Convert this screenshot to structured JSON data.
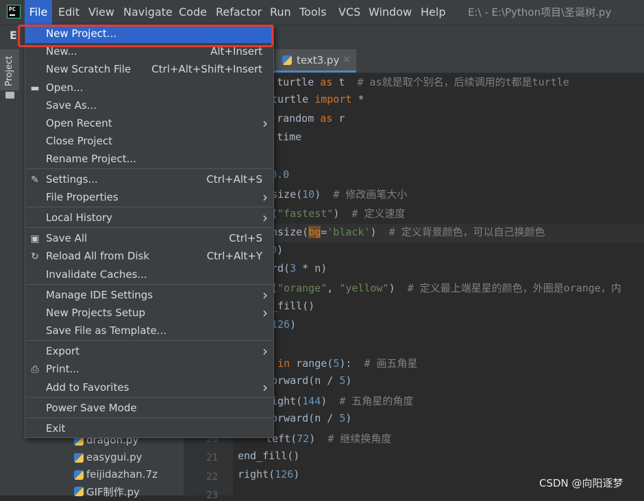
{
  "menubar": {
    "items": [
      "File",
      "Edit",
      "View",
      "Navigate",
      "Code",
      "Refactor",
      "Run",
      "Tools",
      "VCS",
      "Window",
      "Help"
    ],
    "window_title": "E:\\ - E:\\Python项目\\圣诞树.py",
    "logo": "PC"
  },
  "navbar": {
    "label": "E"
  },
  "sidebar": {
    "project_label": "Project"
  },
  "editor_tab": {
    "label": "text3.py",
    "close": "×"
  },
  "project_files": [
    "dragon.py",
    "easygui.py",
    "feijidazhan.7z",
    "GIF制作.py"
  ],
  "line_numbers": [
    "20",
    "21",
    "22",
    "23"
  ],
  "code_lines": [
    [
      {
        "t": "t ",
        "c": "kw"
      },
      {
        "t": "turtle ",
        "c": ""
      },
      {
        "t": "as",
        "c": "kw"
      },
      {
        "t": " t  ",
        "c": ""
      },
      {
        "t": "# as就是取个别名，后续调用的t都是turtle",
        "c": "cmt"
      }
    ],
    [
      {
        "t": "turtle ",
        "c": ""
      },
      {
        "t": "import",
        "c": "kw"
      },
      {
        "t": " *",
        "c": ""
      }
    ],
    [
      {
        "t": "t ",
        "c": "kw"
      },
      {
        "t": "random ",
        "c": ""
      },
      {
        "t": "as",
        "c": "kw"
      },
      {
        "t": " r",
        "c": ""
      }
    ],
    [
      {
        "t": "t ",
        "c": "kw"
      },
      {
        "t": "time",
        "c": ""
      }
    ],
    [],
    [
      {
        "t": "00.0",
        "c": "num"
      }
    ],
    [
      {
        "t": "size(",
        "c": ""
      },
      {
        "t": "10",
        "c": "num"
      },
      {
        "t": ")  ",
        "c": ""
      },
      {
        "t": "# 修改画笔大小",
        "c": "cmt"
      }
    ],
    [
      {
        "t": "(",
        "c": ""
      },
      {
        "t": "\"fastest\"",
        "c": "str"
      },
      {
        "t": ")  ",
        "c": ""
      },
      {
        "t": "# 定义速度",
        "c": "cmt"
      }
    ],
    [
      {
        "t": "nsize(",
        "c": ""
      },
      {
        "t": "bg",
        "c": "hl"
      },
      {
        "t": "=",
        "c": ""
      },
      {
        "t": "'black'",
        "c": "str"
      },
      {
        "t": ")  ",
        "c": ""
      },
      {
        "t": "# 定义背景颜色，可以自己换颜色",
        "c": "cmt"
      }
    ],
    [
      {
        "t": "90",
        "c": "num"
      },
      {
        "t": ")",
        "c": ""
      }
    ],
    [
      {
        "t": "rd(",
        "c": ""
      },
      {
        "t": "3",
        "c": "num"
      },
      {
        "t": " * n)",
        "c": ""
      }
    ],
    [
      {
        "t": "(",
        "c": ""
      },
      {
        "t": "\"orange\"",
        "c": "str"
      },
      {
        "t": ", ",
        "c": ""
      },
      {
        "t": "\"yellow\"",
        "c": "str"
      },
      {
        "t": ")  ",
        "c": ""
      },
      {
        "t": "# 定义最上端星星的颜色，外圈是orange，内",
        "c": "cmt"
      }
    ],
    [
      {
        "t": "_fill()",
        "c": ""
      }
    ],
    [
      {
        "t": "126",
        "c": "num"
      },
      {
        "t": ")",
        "c": ""
      }
    ],
    [],
    [
      {
        "t": " in ",
        "c": "kw"
      },
      {
        "t": "range(",
        "c": ""
      },
      {
        "t": "5",
        "c": "num"
      },
      {
        "t": "):  ",
        "c": ""
      },
      {
        "t": "# 画五角星",
        "c": "cmt"
      }
    ],
    [
      {
        "t": "orward(n / ",
        "c": ""
      },
      {
        "t": "5",
        "c": "num"
      },
      {
        "t": ")",
        "c": ""
      }
    ],
    [
      {
        "t": "ight(",
        "c": ""
      },
      {
        "t": "144",
        "c": "num"
      },
      {
        "t": ")  ",
        "c": ""
      },
      {
        "t": "# 五角星的角度",
        "c": "cmt"
      }
    ],
    [
      {
        "t": "orward(n / ",
        "c": ""
      },
      {
        "t": "5",
        "c": "num"
      },
      {
        "t": ")",
        "c": ""
      }
    ],
    [
      {
        "t": "left(",
        "c": ""
      },
      {
        "t": "72",
        "c": "num"
      },
      {
        "t": ")  ",
        "c": ""
      },
      {
        "t": "# 继续换角度",
        "c": "cmt"
      }
    ],
    [
      {
        "t": "end_fill()",
        "c": ""
      }
    ],
    [
      {
        "t": "right(",
        "c": ""
      },
      {
        "t": "126",
        "c": "num"
      },
      {
        "t": ")",
        "c": ""
      }
    ]
  ],
  "file_menu": {
    "items": [
      {
        "label": "New Project...",
        "shortcut": "",
        "submenu": false,
        "selected": true,
        "icon": ""
      },
      {
        "label": "New...",
        "shortcut": "Alt+Insert",
        "submenu": false,
        "icon": ""
      },
      {
        "label": "New Scratch File",
        "shortcut": "Ctrl+Alt+Shift+Insert",
        "submenu": false,
        "icon": ""
      },
      {
        "label": "Open...",
        "shortcut": "",
        "submenu": false,
        "icon": "folder-icon"
      },
      {
        "label": "Save As...",
        "shortcut": "",
        "submenu": false,
        "icon": ""
      },
      {
        "label": "Open Recent",
        "shortcut": "",
        "submenu": true,
        "icon": ""
      },
      {
        "label": "Close Project",
        "shortcut": "",
        "submenu": false,
        "icon": ""
      },
      {
        "label": "Rename Project...",
        "shortcut": "",
        "submenu": false,
        "icon": ""
      },
      {
        "label": "Settings...",
        "shortcut": "Ctrl+Alt+S",
        "submenu": false,
        "icon": "wrench-icon"
      },
      {
        "label": "File Properties",
        "shortcut": "",
        "submenu": true,
        "icon": ""
      },
      {
        "label": "Local History",
        "shortcut": "",
        "submenu": true,
        "icon": ""
      },
      {
        "label": "Save All",
        "shortcut": "Ctrl+S",
        "submenu": false,
        "icon": "save-icon"
      },
      {
        "label": "Reload All from Disk",
        "shortcut": "Ctrl+Alt+Y",
        "submenu": false,
        "icon": "reload-icon"
      },
      {
        "label": "Invalidate Caches...",
        "shortcut": "",
        "submenu": false,
        "icon": ""
      },
      {
        "label": "Manage IDE Settings",
        "shortcut": "",
        "submenu": true,
        "icon": ""
      },
      {
        "label": "New Projects Setup",
        "shortcut": "",
        "submenu": true,
        "icon": ""
      },
      {
        "label": "Save File as Template...",
        "shortcut": "",
        "submenu": false,
        "icon": ""
      },
      {
        "label": "Export",
        "shortcut": "",
        "submenu": true,
        "icon": ""
      },
      {
        "label": "Print...",
        "shortcut": "",
        "submenu": false,
        "icon": "printer-icon"
      },
      {
        "label": "Add to Favorites",
        "shortcut": "",
        "submenu": true,
        "icon": ""
      },
      {
        "label": "Power Save Mode",
        "shortcut": "",
        "submenu": false,
        "icon": ""
      },
      {
        "label": "Exit",
        "shortcut": "",
        "submenu": false,
        "icon": ""
      }
    ]
  },
  "watermark": "CSDN @向阳逐梦",
  "colors": {
    "accent": "#2f65ca",
    "highlight_box": "#e53935"
  }
}
